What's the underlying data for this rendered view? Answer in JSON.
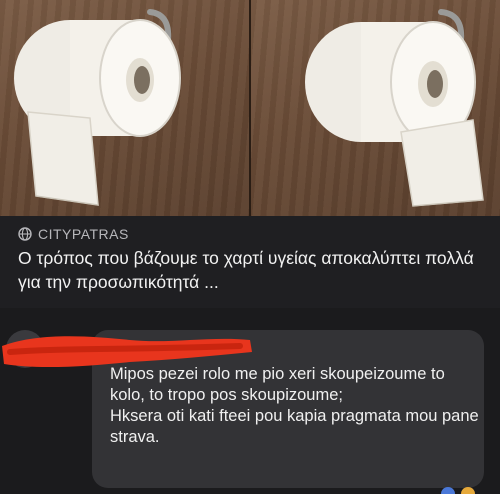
{
  "post": {
    "source": "CITYPATRAS",
    "icon": "globe-icon",
    "headline": "Ο τρόπος που βάζουμε το χαρτί υγείας αποκαλύπτει πολλά για την προσωπικότητά ..."
  },
  "comment": {
    "author": "",
    "text": "Mipos pezei rolo me pio xeri skoupeizoume to kolo, to tropo pos skoupizoume;\nHksera oti kati fteei pou kapia pragmata mou pane strava."
  },
  "colors": {
    "background": "#1c1c1e",
    "bubble": "#333336",
    "redaction": "#e8351d",
    "wood": "#6a4c37",
    "paper": "#f2efe8"
  }
}
